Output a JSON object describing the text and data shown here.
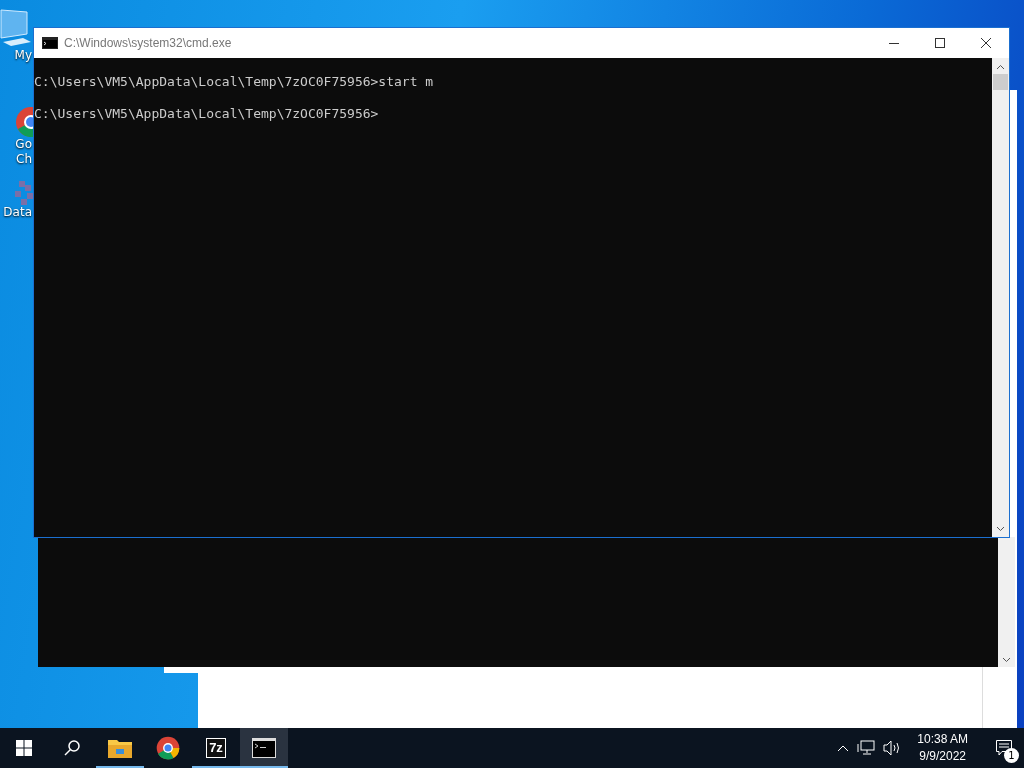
{
  "desktop_icons": [
    {
      "kind": "computer",
      "lines": [
        "My"
      ]
    },
    {
      "kind": "browser",
      "lines": [
        "Go",
        "Ch"
      ]
    },
    {
      "kind": "grid",
      "lines": [
        "Data"
      ]
    }
  ],
  "console_window": {
    "title": "C:\\Windows\\system32\\cmd.exe",
    "lines": [
      "C:\\Users\\VM5\\AppData\\Local\\Temp\\7zOC0F75956>start m",
      "C:\\Users\\VM5\\AppData\\Local\\Temp\\7zOC0F75956>"
    ]
  },
  "taskbar": {
    "apps": [
      {
        "kind": "folder",
        "running": true,
        "selected": false
      },
      {
        "kind": "browser",
        "running": false,
        "selected": false
      },
      {
        "kind": "archive",
        "text": "7z",
        "running": true,
        "selected": false
      },
      {
        "kind": "console",
        "running": true,
        "selected": true
      }
    ],
    "time": "10:38 AM",
    "date": "9/9/2022",
    "notifications": "1"
  }
}
